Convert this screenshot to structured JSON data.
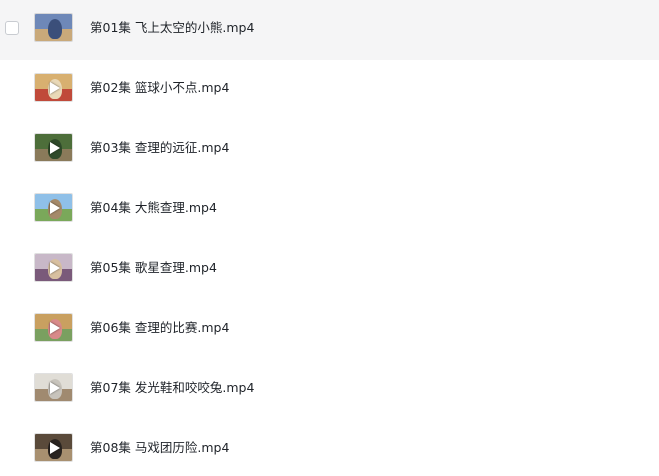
{
  "files": [
    {
      "name": "第01集 飞上太空的小熊.mp4",
      "thumb_colors": [
        "#6e88b8",
        "#c9a97a",
        "#3b4f7a"
      ],
      "has_play": false,
      "selected": false,
      "hovered": true
    },
    {
      "name": "第02集 篮球小不点.mp4",
      "thumb_colors": [
        "#d8b070",
        "#c04a3a",
        "#e9d9b8"
      ],
      "has_play": true,
      "selected": false,
      "hovered": false
    },
    {
      "name": "第03集 查理的远征.mp4",
      "thumb_colors": [
        "#4d6e3a",
        "#8a7a5a",
        "#2f4a2a"
      ],
      "has_play": true,
      "selected": false,
      "hovered": false
    },
    {
      "name": "第04集 大熊查理.mp4",
      "thumb_colors": [
        "#8fc0e8",
        "#7aa85a",
        "#a58a6a"
      ],
      "has_play": true,
      "selected": false,
      "hovered": false
    },
    {
      "name": "第05集 歌星查理.mp4",
      "thumb_colors": [
        "#c8b8c8",
        "#7a5a7a",
        "#d8c0a0"
      ],
      "has_play": true,
      "selected": false,
      "hovered": false
    },
    {
      "name": "第06集 查理的比赛.mp4",
      "thumb_colors": [
        "#c9a060",
        "#7aa060",
        "#d88a8a"
      ],
      "has_play": true,
      "selected": false,
      "hovered": false
    },
    {
      "name": "第07集 发光鞋和咬咬兔.mp4",
      "thumb_colors": [
        "#e0ddd6",
        "#a08a70",
        "#c8c4bc"
      ],
      "has_play": true,
      "selected": false,
      "hovered": false
    },
    {
      "name": "第08集 马戏团历险.mp4",
      "thumb_colors": [
        "#5a4a3a",
        "#a89070",
        "#2a2420"
      ],
      "has_play": true,
      "selected": false,
      "hovered": false
    }
  ]
}
